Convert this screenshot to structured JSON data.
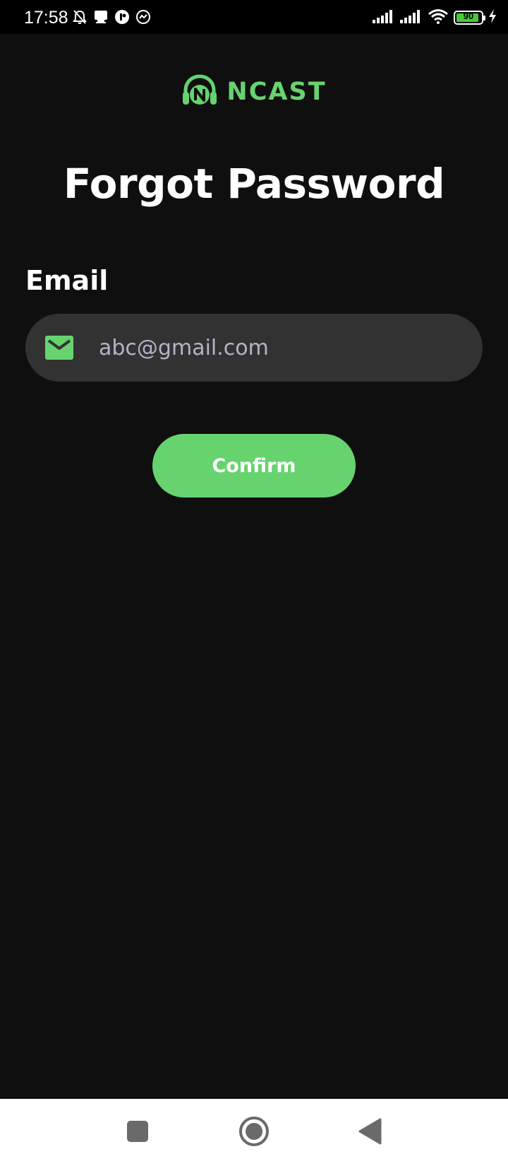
{
  "status_bar": {
    "time": "17:58",
    "battery_level": "90",
    "battery_fraction": 0.9,
    "icons": [
      "bell-off-icon",
      "notification-icon",
      "app-icon",
      "messenger-icon",
      "signal-icon",
      "signal-icon",
      "wifi-icon",
      "battery-icon",
      "charging-icon"
    ]
  },
  "logo": {
    "text": "NCAST",
    "color": "#67d36f"
  },
  "page": {
    "title": "Forgot Password"
  },
  "form": {
    "email_label": "Email",
    "email_value": "abc@gmail.com",
    "email_placeholder": "abc@gmail.com",
    "confirm_label": "Confirm"
  },
  "nav": {
    "buttons": [
      "recents-button",
      "home-button",
      "back-button"
    ]
  },
  "colors": {
    "accent": "#67d36f",
    "background": "#0f0f0f",
    "field_background": "#323232",
    "field_text": "#b3b3cc"
  }
}
